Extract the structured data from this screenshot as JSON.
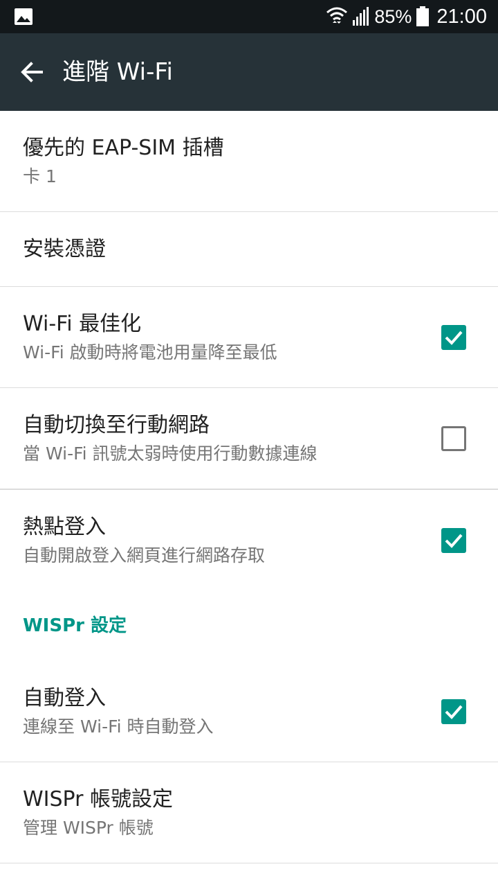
{
  "status_bar": {
    "battery": "85%",
    "time": "21:00",
    "icons": [
      "image-notification-icon",
      "wifi-icon",
      "cell-signal-icon",
      "battery-icon"
    ]
  },
  "app_bar": {
    "title": "進階 Wi-Fi",
    "back_icon": "arrow-back-icon"
  },
  "settings": {
    "eap_sim": {
      "title": "優先的 EAP-SIM 插槽",
      "summary": "卡 1"
    },
    "install_cert": {
      "title": "安裝憑證"
    },
    "wifi_optimize": {
      "title": "Wi-Fi 最佳化",
      "summary": "Wi-Fi 啟動時將電池用量降至最低",
      "checked": true
    },
    "auto_switch": {
      "title": "自動切換至行動網路",
      "summary": "當 Wi-Fi 訊號太弱時使用行動數據連線",
      "checked": false
    },
    "hotspot_login": {
      "title": "熱點登入",
      "summary": "自動開啟登入網頁進行網路存取",
      "checked": true
    }
  },
  "wispr": {
    "header": "WISPr 設定",
    "auto_login": {
      "title": "自動登入",
      "summary": "連線至 Wi-Fi 時自動登入",
      "checked": true
    },
    "account": {
      "title": "WISPr 帳號設定",
      "summary": "管理 WISPr 帳號"
    }
  },
  "colors": {
    "accent": "#009688",
    "app_bar": "#263238",
    "status_bar": "#13181b"
  }
}
